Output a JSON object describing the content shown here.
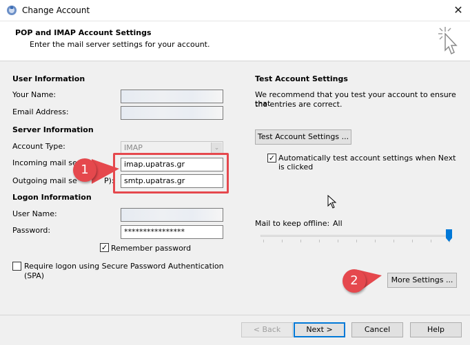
{
  "window": {
    "title": "Change Account",
    "close_glyph": "✕"
  },
  "header": {
    "title": "POP and IMAP Account Settings",
    "subtitle": "Enter the mail server settings for your account."
  },
  "user_info": {
    "heading": "User Information",
    "name_label": "Your Name:",
    "name_value": "",
    "email_label": "Email Address:",
    "email_value": ""
  },
  "server_info": {
    "heading": "Server Information",
    "account_type_label": "Account Type:",
    "account_type_value": "IMAP",
    "incoming_label": "Incoming mail serv",
    "incoming_value": "imap.upatras.gr",
    "outgoing_label": "Outgoing mail se",
    "outgoing_label_tail": "P):",
    "outgoing_value": "smtp.upatras.gr"
  },
  "logon_info": {
    "heading": "Logon Information",
    "username_label": "User Name:",
    "username_value": "",
    "password_label": "Password:",
    "password_value": "****************",
    "remember_label": "Remember password",
    "remember_checked": true,
    "spa_label_line1": "Require logon using Secure Password Authentication",
    "spa_label_line2": "(SPA)",
    "spa_checked": false
  },
  "test_settings": {
    "heading": "Test Account Settings",
    "description_line1": "We recommend that you test your account to ensure that",
    "description_line2": "the entries are correct.",
    "test_button": "Test Account Settings ...",
    "auto_test_line1": "Automatically test account settings when Next",
    "auto_test_line2": "is clicked",
    "auto_test_checked": true
  },
  "offline": {
    "label": "Mail to keep offline:",
    "value": "All",
    "slider_level": 1.0
  },
  "more_settings_button": "More Settings ...",
  "callouts": {
    "badge1": "1",
    "badge2": "2",
    "color": "#e5484d"
  },
  "footer": {
    "back": "< Back",
    "next": "Next >",
    "cancel": "Cancel",
    "help": "Help"
  },
  "icons": {
    "app": "outlook-account-icon",
    "header_art": "cursor-sparkle-icon",
    "pointer": "mouse-pointer-icon"
  }
}
